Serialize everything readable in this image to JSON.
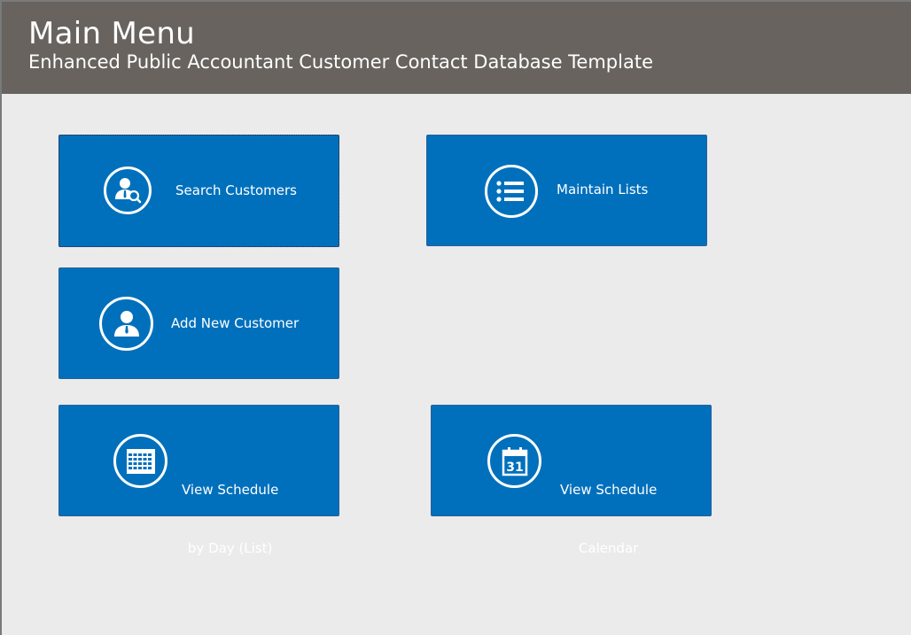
{
  "header": {
    "title": "Main Menu",
    "subtitle": "Enhanced Public Accountant Customer Contact Database Template"
  },
  "tiles": [
    {
      "label": "Search Customers",
      "icon": "search-customer-icon"
    },
    {
      "label": "Maintain Lists",
      "icon": "list-icon"
    },
    {
      "label": "Add New Customer",
      "icon": "add-customer-icon"
    },
    {
      "label_line1": "View Schedule",
      "label_line2": "by Day (List)",
      "icon": "calendar-grid-icon"
    },
    {
      "label_line1": "View Schedule",
      "label_line2": "Calendar",
      "icon": "calendar-31-icon"
    }
  ],
  "calendar_day_number": "31",
  "colors": {
    "header_bg": "#68635e",
    "tile_bg": "#0070bc",
    "page_bg": "#ebebeb",
    "text": "#ffffff"
  }
}
